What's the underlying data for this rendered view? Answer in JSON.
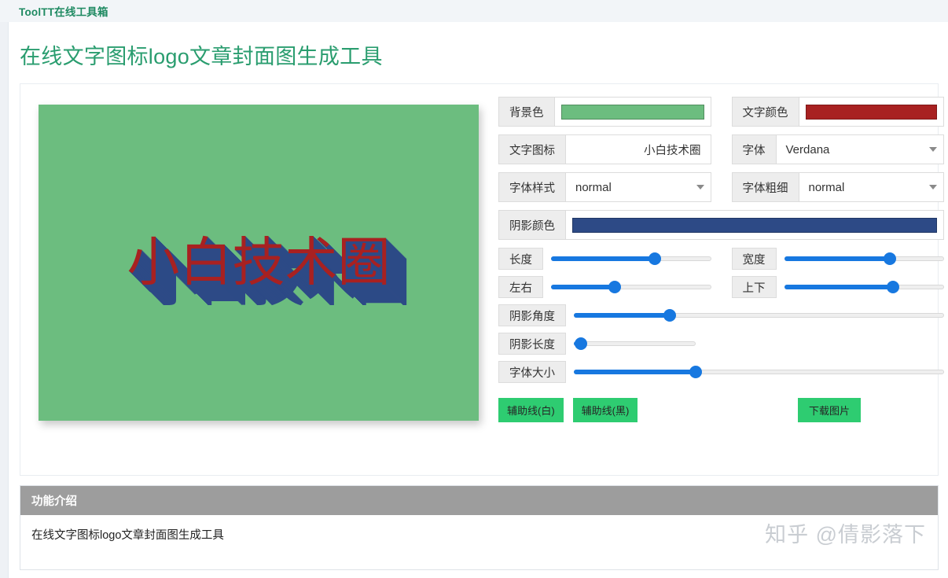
{
  "nav": {
    "brand": "ToolTT在线工具箱"
  },
  "page": {
    "title": "在线文字图标logo文章封面图生成工具"
  },
  "preview": {
    "text": "小白技术圈",
    "background_color": "#6cbd7f",
    "text_color": "#a82121",
    "shadow_color": "#2d4a86"
  },
  "controls": {
    "background_color": {
      "label": "背景色",
      "value": "#6cbd7f"
    },
    "text_color": {
      "label": "文字颜色",
      "value": "#a82121"
    },
    "text_icon": {
      "label": "文字图标",
      "value": "小白技术圈"
    },
    "font_family": {
      "label": "字体",
      "value": "Verdana"
    },
    "font_style": {
      "label": "字体样式",
      "value": "normal"
    },
    "font_weight": {
      "label": "字体粗细",
      "value": "normal"
    },
    "shadow_color": {
      "label": "阴影颜色",
      "value": "#2d4a86"
    },
    "sliders": [
      {
        "name": "length",
        "label": "长度",
        "percent": 65
      },
      {
        "name": "width",
        "label": "宽度",
        "percent": 66
      },
      {
        "name": "horizontal",
        "label": "左右",
        "percent": 40
      },
      {
        "name": "vertical",
        "label": "上下",
        "percent": 68
      },
      {
        "name": "shadow-angle",
        "label": "阴影角度",
        "percent": 26
      },
      {
        "name": "shadow-length",
        "label": "阴影长度",
        "percent": 6
      },
      {
        "name": "font-size",
        "label": "字体大小",
        "percent": 33
      }
    ]
  },
  "buttons": {
    "guide_white": "辅助线(白)",
    "guide_black": "辅助线(黑)",
    "download": "下载图片"
  },
  "info": {
    "heading": "功能介绍",
    "body": "在线文字图标logo文章封面图生成工具"
  },
  "watermark": {
    "text": "知乎 @倩影落下"
  }
}
